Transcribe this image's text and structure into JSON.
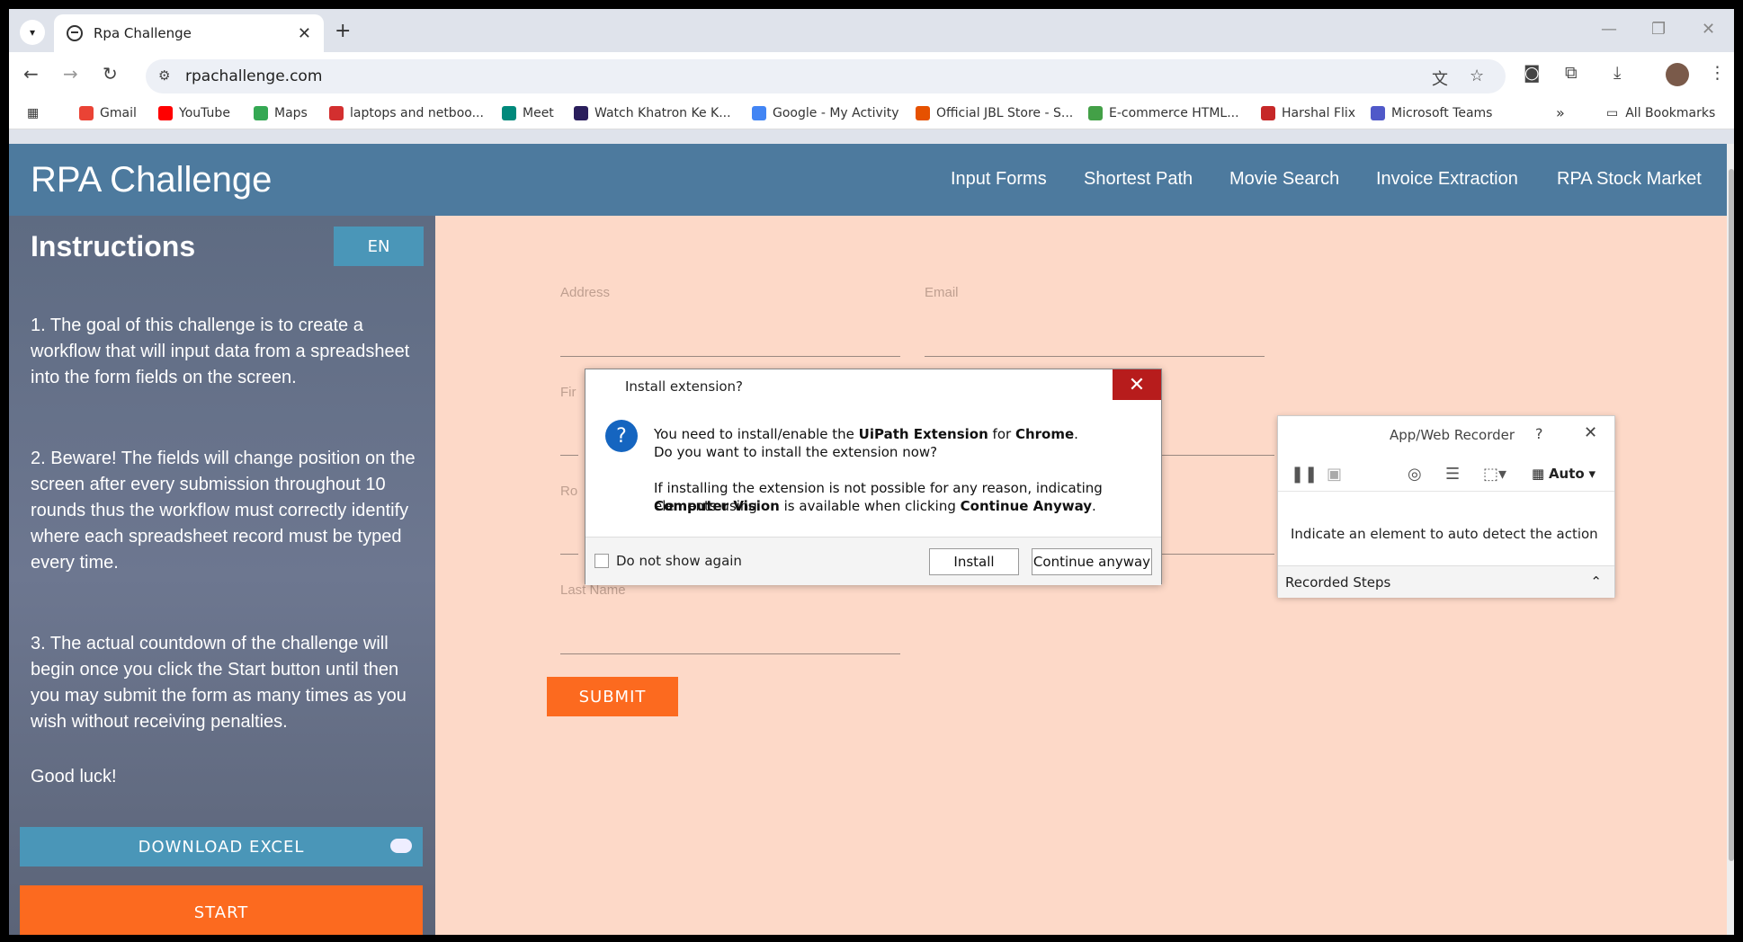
{
  "browser": {
    "tab_title": "Rpa Challenge",
    "url": "rpachallenge.com",
    "new_tab": "+",
    "close_tab": "✕",
    "bookmarks": [
      "Gmail",
      "YouTube",
      "Maps",
      "laptops and netboo...",
      "Meet",
      "Watch Khatron Ke K...",
      "Google - My Activity",
      "Official JBL Store - S...",
      "E-commerce HTML...",
      "Harshal Flix",
      "Microsoft Teams"
    ],
    "all_bookmarks": "All Bookmarks",
    "more_bookmarks": "»"
  },
  "site": {
    "title": "RPA Challenge",
    "nav": [
      "Input Forms",
      "Shortest Path",
      "Movie Search",
      "Invoice Extraction",
      "RPA Stock Market"
    ]
  },
  "sidebar": {
    "title": "Instructions",
    "lang": "EN",
    "paragraphs": [
      "1. The goal of this challenge is to create a workflow that will input data from a spreadsheet into the form fields on the screen.",
      "2. Beware! The fields will change position on the screen after every submission throughout 10 rounds thus the workflow must correctly identify where each spreadsheet record must be typed every time.",
      "3. The actual countdown of the challenge will begin once you click the Start button until then you may submit the form as many times as you wish without receiving penalties.",
      "Good luck!"
    ],
    "download_label": "DOWNLOAD EXCEL",
    "start_label": "START"
  },
  "form": {
    "address_label": "Address",
    "email_label": "Email",
    "first_name_label_partial": "Fir",
    "role_label_partial": "Ro",
    "last_name_label": "Last Name",
    "submit_label": "SUBMIT"
  },
  "dialog": {
    "title": "Install extension?",
    "close": "✕",
    "line1_pre": "You need to install/enable the ",
    "line1_bold1": "UiPath Extension",
    "line1_mid": " for ",
    "line1_bold2": "Chrome",
    "line1_end": ".",
    "line2": "Do you want to install the extension now?",
    "line3": "If installing the extension is not possible for any reason, indicating elements using",
    "line4_bold1": "Computer Vision",
    "line4_mid": " is available when clicking ",
    "line4_bold2": "Continue Anyway",
    "line4_end": ".",
    "checkbox_label": "Do not show again",
    "install_label": "Install",
    "continue_label": "Continue anyway"
  },
  "recorder": {
    "title": "App/Web Recorder",
    "help": "?",
    "close": "✕",
    "mode": "Auto",
    "message": "Indicate an element to auto detect the action",
    "steps_label": "Recorded Steps"
  }
}
